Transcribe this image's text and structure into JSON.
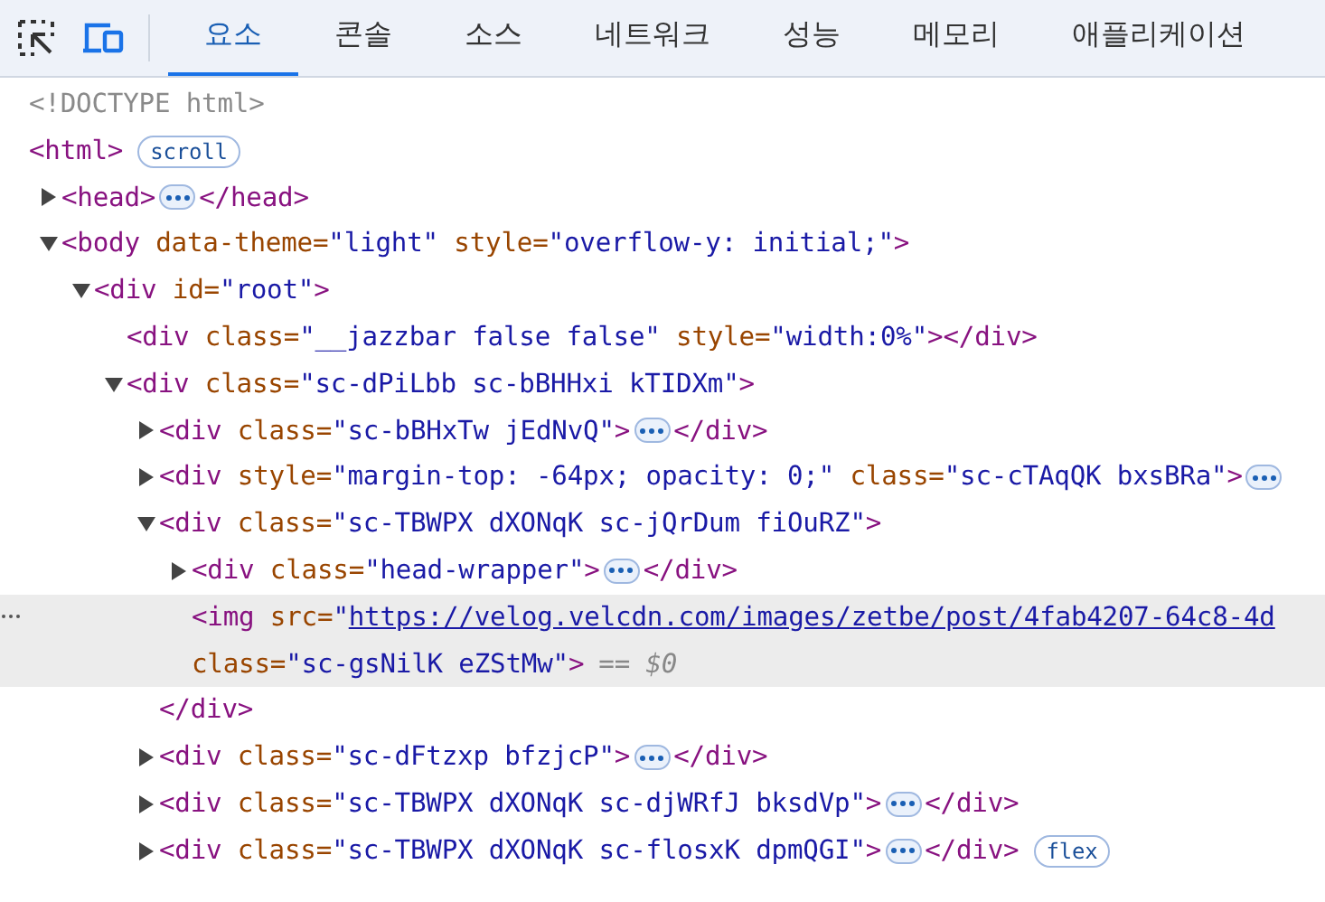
{
  "toolbar": {
    "tabs": [
      {
        "label": "요소",
        "selected": true
      },
      {
        "label": "콘솔",
        "selected": false
      },
      {
        "label": "소스",
        "selected": false
      },
      {
        "label": "네트워크",
        "selected": false
      },
      {
        "label": "성능",
        "selected": false
      },
      {
        "label": "메모리",
        "selected": false
      },
      {
        "label": "애플리케이션",
        "selected": false
      }
    ]
  },
  "dom_tree": [
    {
      "selected": false,
      "lines": [
        [
          {
            "kind": "text",
            "t": "<!DOCTYPE html>"
          }
        ]
      ]
    },
    {
      "selected": false,
      "lines": [
        [
          {
            "kind": "tag",
            "t": "<html>"
          }
        ]
      ],
      "badge": "scroll",
      "children": [
        {
          "selected": false,
          "expanded": false,
          "collapsed": true,
          "lines": [
            [
              {
                "kind": "tag",
                "t": "<head>"
              }
            ]
          ],
          "close": [
            {
              "kind": "tag",
              "t": "</head>"
            }
          ]
        },
        {
          "selected": false,
          "expanded": true,
          "lines": [
            [
              {
                "kind": "tag",
                "t": "<body"
              },
              {
                "kind": "attr",
                "t": " data-theme="
              },
              {
                "kind": "value",
                "t": "\"light\""
              },
              {
                "kind": "attr",
                "t": " style="
              },
              {
                "kind": "value",
                "t": "\"overflow-y: initial;\""
              },
              {
                "kind": "tag",
                "t": ">"
              }
            ]
          ],
          "children": [
            {
              "selected": false,
              "expanded": true,
              "lines": [
                [
                  {
                    "kind": "tag",
                    "t": "<div"
                  },
                  {
                    "kind": "attr",
                    "t": " id="
                  },
                  {
                    "kind": "value",
                    "t": "\"root\""
                  },
                  {
                    "kind": "tag",
                    "t": ">"
                  }
                ]
              ],
              "children": [
                {
                  "selected": false,
                  "lines": [
                    [
                      {
                        "kind": "tag",
                        "t": "<div"
                      },
                      {
                        "kind": "attr",
                        "t": " class="
                      },
                      {
                        "kind": "value",
                        "t": "\"__jazzbar false false\""
                      },
                      {
                        "kind": "attr",
                        "t": " style="
                      },
                      {
                        "kind": "value",
                        "t": "\"width:0%\""
                      },
                      {
                        "kind": "tag",
                        "t": "></div>"
                      }
                    ]
                  ]
                },
                {
                  "selected": false,
                  "expanded": true,
                  "lines": [
                    [
                      {
                        "kind": "tag",
                        "t": "<div"
                      },
                      {
                        "kind": "attr",
                        "t": " class="
                      },
                      {
                        "kind": "value",
                        "t": "\"sc-dPiLbb sc-bBHHxi kTIDXm\""
                      },
                      {
                        "kind": "tag",
                        "t": ">"
                      }
                    ]
                  ],
                  "children": [
                    {
                      "selected": false,
                      "expanded": false,
                      "collapsed": true,
                      "lines": [
                        [
                          {
                            "kind": "tag",
                            "t": "<div"
                          },
                          {
                            "kind": "attr",
                            "t": " class="
                          },
                          {
                            "kind": "value",
                            "t": "\"sc-bBHxTw jEdNvQ\""
                          },
                          {
                            "kind": "tag",
                            "t": ">"
                          }
                        ]
                      ],
                      "close": [
                        {
                          "kind": "tag",
                          "t": "</div>"
                        }
                      ]
                    },
                    {
                      "selected": false,
                      "expanded": false,
                      "collapsed": true,
                      "lines": [
                        [
                          {
                            "kind": "tag",
                            "t": "<div"
                          },
                          {
                            "kind": "attr",
                            "t": " style="
                          },
                          {
                            "kind": "value",
                            "t": "\"margin-top: -64px; opacity: 0;\""
                          },
                          {
                            "kind": "attr",
                            "t": " class="
                          },
                          {
                            "kind": "value",
                            "t": "\"sc-cTAqQK bxsBRa\""
                          },
                          {
                            "kind": "tag",
                            "t": ">"
                          }
                        ]
                      ]
                    },
                    {
                      "selected": false,
                      "expanded": true,
                      "lines": [
                        [
                          {
                            "kind": "tag",
                            "t": "<div"
                          },
                          {
                            "kind": "attr",
                            "t": " class="
                          },
                          {
                            "kind": "value",
                            "t": "\"sc-TBWPX dXONqK sc-jQrDum fiOuRZ\""
                          },
                          {
                            "kind": "tag",
                            "t": ">"
                          }
                        ]
                      ],
                      "end": [
                        {
                          "kind": "tag",
                          "t": "</div>"
                        }
                      ],
                      "children": [
                        {
                          "selected": false,
                          "expanded": false,
                          "collapsed": true,
                          "lines": [
                            [
                              {
                                "kind": "tag",
                                "t": "<div"
                              },
                              {
                                "kind": "attr",
                                "t": " class="
                              },
                              {
                                "kind": "value",
                                "t": "\"head-wrapper\""
                              },
                              {
                                "kind": "tag",
                                "t": ">"
                              }
                            ]
                          ],
                          "close": [
                            {
                              "kind": "tag",
                              "t": "</div>"
                            }
                          ]
                        },
                        {
                          "selected": true,
                          "lines": [
                            [
                              {
                                "kind": "tag",
                                "t": "<img"
                              },
                              {
                                "kind": "attr",
                                "t": " src="
                              },
                              {
                                "kind": "value",
                                "t": "\""
                              },
                              {
                                "kind": "link",
                                "t": "https://velog.velcdn.com/images/zetbe/post/4fab4207-64c8-4d"
                              }
                            ],
                            [
                              {
                                "kind": "attr",
                                "t": "class="
                              },
                              {
                                "kind": "value",
                                "t": "\"sc-gsNilK eZStMw\""
                              },
                              {
                                "kind": "tag",
                                "t": ">"
                              }
                            ]
                          ],
                          "note": "== $0"
                        }
                      ]
                    },
                    {
                      "selected": false,
                      "expanded": false,
                      "collapsed": true,
                      "lines": [
                        [
                          {
                            "kind": "tag",
                            "t": "<div"
                          },
                          {
                            "kind": "attr",
                            "t": " class="
                          },
                          {
                            "kind": "value",
                            "t": "\"sc-dFtzxp bfzjcP\""
                          },
                          {
                            "kind": "tag",
                            "t": ">"
                          }
                        ]
                      ],
                      "close": [
                        {
                          "kind": "tag",
                          "t": "</div>"
                        }
                      ]
                    },
                    {
                      "selected": false,
                      "expanded": false,
                      "collapsed": true,
                      "lines": [
                        [
                          {
                            "kind": "tag",
                            "t": "<div"
                          },
                          {
                            "kind": "attr",
                            "t": " class="
                          },
                          {
                            "kind": "value",
                            "t": "\"sc-TBWPX dXONqK sc-djWRfJ bksdVp\""
                          },
                          {
                            "kind": "tag",
                            "t": ">"
                          }
                        ]
                      ],
                      "close": [
                        {
                          "kind": "tag",
                          "t": "</div>"
                        }
                      ]
                    },
                    {
                      "selected": false,
                      "expanded": false,
                      "collapsed": true,
                      "lines": [
                        [
                          {
                            "kind": "tag",
                            "t": "<div"
                          },
                          {
                            "kind": "attr",
                            "t": " class="
                          },
                          {
                            "kind": "value",
                            "t": "\"sc-TBWPX dXONqK sc-flosxK dpmQGI\""
                          },
                          {
                            "kind": "tag",
                            "t": ">"
                          }
                        ]
                      ],
                      "close": [
                        {
                          "kind": "tag",
                          "t": "</div>"
                        }
                      ],
                      "badge": "flex"
                    }
                  ]
                }
              ]
            }
          ]
        }
      ]
    }
  ]
}
